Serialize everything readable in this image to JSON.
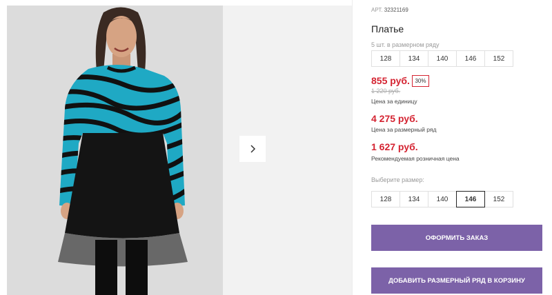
{
  "product": {
    "article_label": "АРТ.",
    "article": "32321169",
    "title": "Платье",
    "pack_label": "5 шт. в размерном ряду",
    "pack_sizes": [
      "128",
      "134",
      "140",
      "146",
      "152"
    ],
    "price_unit": "855 руб.",
    "discount": "30%",
    "old_price": "1 220 руб.",
    "price_unit_caption": "Цена за единицу",
    "price_row": "4 275 руб.",
    "price_row_caption": "Цена за размерный ряд",
    "price_retail": "1 627 руб.",
    "price_retail_caption": "Рекомендуемая розничная цена",
    "select_size_label": "Выберите размер:",
    "select_sizes": [
      "128",
      "134",
      "140",
      "146",
      "152"
    ],
    "selected_size": "146"
  },
  "actions": {
    "checkout_label": "ОФОРМИТЬ ЗАКАЗ",
    "add_row_label": "ДОБАВИТЬ РАЗМЕРНЫЙ РЯД В КОРЗИНУ"
  },
  "colors": {
    "accent": "#7c62a8",
    "price": "#d42331",
    "dress_top": "#1fa9c4",
    "dress_stripes": "#111111",
    "skirt": "#111111"
  },
  "icons": {
    "next": "chevron-right-icon"
  }
}
